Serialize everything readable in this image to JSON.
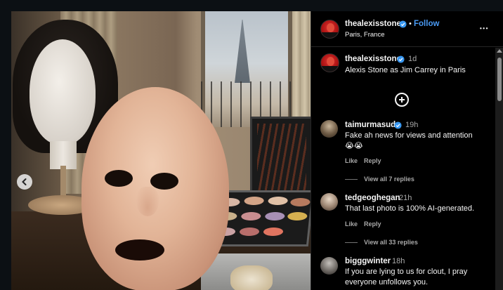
{
  "header": {
    "username": "thealexisstone",
    "follow_dot": "•",
    "follow_label": "Follow",
    "location": "Paris, France",
    "more_label": "•••"
  },
  "caption": {
    "username": "thealexisstone",
    "time": "1d",
    "text": "Alexis Stone as Jim Carrey in Paris"
  },
  "load_more_icon": "plus-circle-icon",
  "comments": [
    {
      "username": "taimurmasud",
      "verified": true,
      "time": "19h",
      "text": "Fake ah news for views and attention",
      "emoji": "😭😭",
      "like_label": "Like",
      "reply_label": "Reply",
      "view_replies": "View all 7 replies"
    },
    {
      "username": "tedgeoghegan",
      "verified": false,
      "time": "21h",
      "text": "That last photo is 100% AI-generated.",
      "like_label": "Like",
      "reply_label": "Reply",
      "view_replies": "View all 33 replies"
    },
    {
      "username": "bigggwinter",
      "verified": false,
      "time": "18h",
      "text_line1": "If you are lying to us for clout, I pray",
      "text_line2": "everyone unfollows you."
    }
  ],
  "colors": {
    "follow": "#4a9bf5",
    "verified": "#3897f0",
    "panel_bg": "#000000",
    "meta": "#a8a8a8"
  }
}
